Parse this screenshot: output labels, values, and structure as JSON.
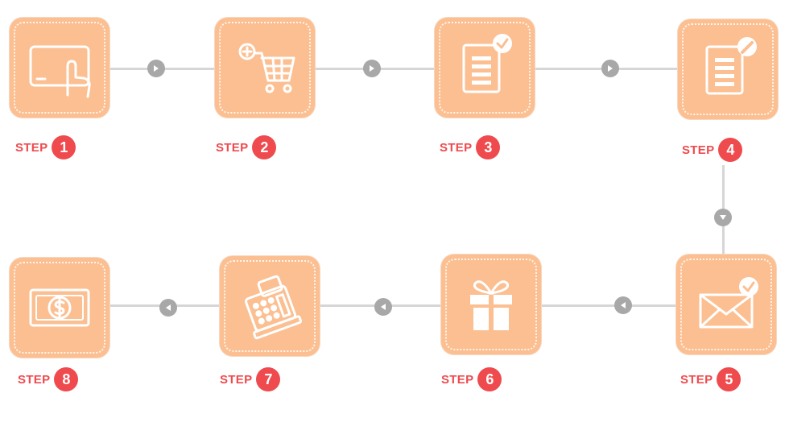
{
  "steps": [
    {
      "word": "STEP",
      "num": "1",
      "icon": "tablet-touch-icon"
    },
    {
      "word": "STEP",
      "num": "2",
      "icon": "shopping-cart-add-icon"
    },
    {
      "word": "STEP",
      "num": "3",
      "icon": "checklist-document-icon"
    },
    {
      "word": "STEP",
      "num": "4",
      "icon": "document-edit-icon"
    },
    {
      "word": "STEP",
      "num": "5",
      "icon": "mail-check-icon"
    },
    {
      "word": "STEP",
      "num": "6",
      "icon": "gift-box-icon"
    },
    {
      "word": "STEP",
      "num": "7",
      "icon": "cash-register-icon"
    },
    {
      "word": "STEP",
      "num": "8",
      "icon": "dollar-bill-icon"
    }
  ],
  "colors": {
    "tile": "#fbbf91",
    "accent": "#ef4a4e",
    "connector": "#d6d6d6",
    "arrow": "#a8a8a8"
  }
}
